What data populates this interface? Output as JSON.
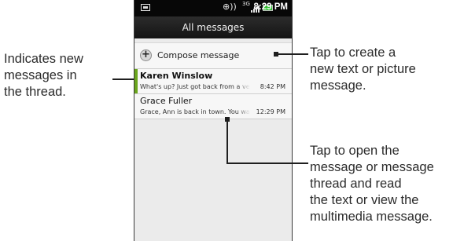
{
  "callouts": {
    "left": [
      "Indicates new",
      "messages in",
      "the thread."
    ],
    "right_top": [
      "Tap to create a",
      "new text or picture",
      "message."
    ],
    "right_bottom": [
      "Tap to open the",
      "message or message",
      "thread and read",
      "the text or view the",
      "multimedia message."
    ]
  },
  "status_bar": {
    "network": "3G",
    "time": "8:29 PM",
    "icons": [
      "notification-icon",
      "gps-icon",
      "network-3g-icon",
      "signal-icon",
      "battery-icon"
    ]
  },
  "screen": {
    "title": "All messages",
    "compose_label": "Compose message"
  },
  "threads": [
    {
      "name": "Karen Winslow",
      "preview": "What's up? Just got back from a very l",
      "time": "8:42 PM",
      "unread": true
    },
    {
      "name": "Grace Fuller",
      "preview": "Grace, Ann is back in town. You want",
      "time": "12:29 PM",
      "unread": false
    }
  ],
  "colors": {
    "unread_indicator": "#6aa51c",
    "status_bar": "#070707",
    "battery": "#2fbf2f"
  }
}
